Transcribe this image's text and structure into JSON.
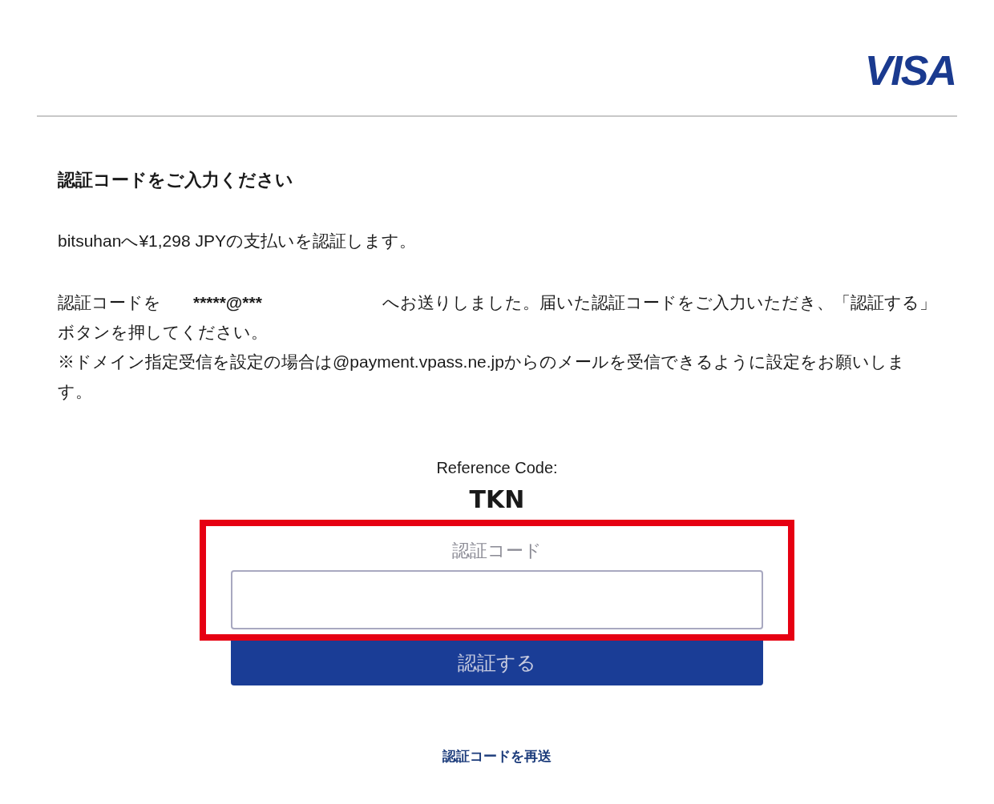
{
  "header": {
    "logo": "VISA"
  },
  "title": "認証コードをご入力ください",
  "payment_text": "bitsuhanへ¥1,298 JPYの支払いを認証します。",
  "sent_message": {
    "before": "認証コードを",
    "email": "*****@***",
    "after": "へお送りしました。届いた認証コードをご入力いただき、「認証する」ボタンを押してください。"
  },
  "domain_note": "※ドメイン指定受信を設定の場合は@payment.vpass.ne.jpからのメールを受信できるように設定をお願いします。",
  "reference": {
    "label": "Reference Code:",
    "value": "TKN"
  },
  "code_field": {
    "placeholder": "認証コード",
    "highlighted": true
  },
  "submit_button": "認証する",
  "resend_link": "認証コードを再送"
}
